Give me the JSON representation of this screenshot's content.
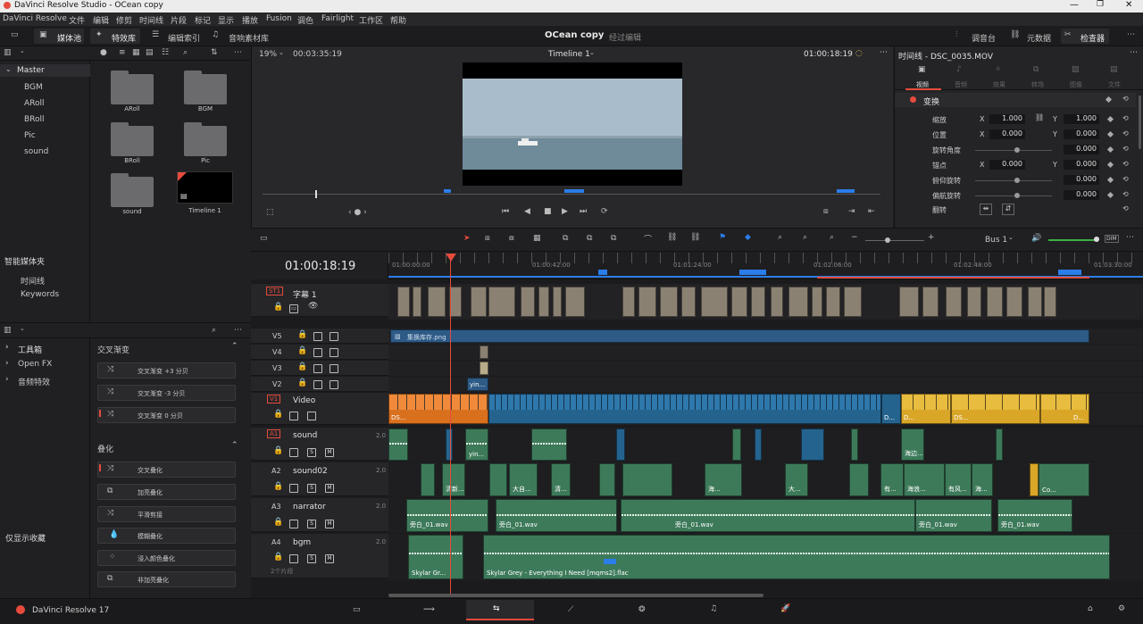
{
  "window": {
    "title": "DaVinci Resolve Studio - OCean copy"
  },
  "menu": [
    "DaVinci Resolve",
    "文件",
    "编辑",
    "修剪",
    "时间线",
    "片段",
    "标记",
    "显示",
    "播放",
    "Fusion",
    "调色",
    "Fairlight",
    "工作区",
    "帮助"
  ],
  "toolbar": {
    "media_pool": "媒体池",
    "effects": "特效库",
    "edit_index": "编辑索引",
    "sound_library": "音响素材库",
    "project_name": "OCean copy",
    "page_status": "经过编辑",
    "mixer": "调音台",
    "metadata": "元数据",
    "inspector": "检查器"
  },
  "viewer": {
    "zoom": "19%",
    "source_tc": "00:03:35:19",
    "timeline_name": "Timeline 1",
    "record_tc": "01:00:18:19"
  },
  "bins": {
    "master": "Master",
    "items": [
      "BGM",
      "ARoll",
      "BRoll",
      "Pic",
      "sound"
    ],
    "smart_bins_title": "智能媒体夹",
    "smart_items": [
      "时间线",
      "Keywords"
    ]
  },
  "clips": [
    {
      "name": "ARoll",
      "type": "folder"
    },
    {
      "name": "BGM",
      "type": "folder"
    },
    {
      "name": "BRoll",
      "type": "folder"
    },
    {
      "name": "Pic",
      "type": "folder"
    },
    {
      "name": "sound",
      "type": "folder"
    },
    {
      "name": "Timeline 1",
      "type": "timeline"
    }
  ],
  "effects_panel": {
    "tree": [
      "工具箱",
      "Open FX",
      "音频特效"
    ],
    "cat1": "交叉渐变",
    "cross": [
      "交叉渐变 +3 分贝",
      "交叉渐变 -3 分贝",
      "交叉渐变 0 分贝"
    ],
    "cat2": "叠化",
    "dissolves": [
      "交叉叠化",
      "加亮叠化",
      "平滑剪接",
      "模糊叠化",
      "浸入颜色叠化",
      "非加亮叠化"
    ],
    "show_favorites": "仅显示收藏"
  },
  "inspector": {
    "title": "时间线 - DSC_0035.MOV",
    "tabs": [
      "视频",
      "音频",
      "效果",
      "转场",
      "图像",
      "文件"
    ],
    "section": "变换",
    "rows": [
      {
        "label": "缩放",
        "x": "1.000",
        "y": "1.000"
      },
      {
        "label": "位置",
        "x": "0.000",
        "y": "0.000"
      },
      {
        "label": "旋转角度",
        "v": "0.000"
      },
      {
        "label": "锚点",
        "x": "0.000",
        "y": "0.000"
      },
      {
        "label": "俯仰旋转",
        "v": "0.000"
      },
      {
        "label": "偏航旋转",
        "v": "0.000"
      },
      {
        "label": "翻转"
      }
    ]
  },
  "timeline": {
    "current_tc": "01:00:18:19",
    "bus": "Bus 1",
    "ruler": [
      "01:00:00:00",
      "01:00:42:00",
      "01:01:24:00",
      "01:02:06:00",
      "01:02:48:00",
      "01:03:30:00"
    ],
    "tracks": [
      {
        "id": "ST1",
        "name": "字幕 1"
      },
      {
        "id": "V5",
        "name": ""
      },
      {
        "id": "V4",
        "name": ""
      },
      {
        "id": "V3",
        "name": ""
      },
      {
        "id": "V2",
        "name": ""
      },
      {
        "id": "V1",
        "name": "Video"
      },
      {
        "id": "A1",
        "name": "sound",
        "ch": "2.0"
      },
      {
        "id": "A2",
        "name": "sound02",
        "ch": "2.0"
      },
      {
        "id": "A3",
        "name": "narrator",
        "ch": "2.0"
      },
      {
        "id": "A4",
        "name": "bgm",
        "ch": "2.0",
        "count": "2个片段"
      }
    ],
    "clip_labels": {
      "v5": "集换库存.png",
      "v2": "yin...",
      "v1a": "DS...",
      "v1b": "D...",
      "v1c": "D...",
      "v1d": "DS...",
      "v1e": "D...",
      "a1": "yin...",
      "a1b": "海边...",
      "a2": [
        "清新...",
        "大自...",
        "清...",
        "海...",
        "大...",
        "有...",
        "海浪...",
        "有风...",
        "海...",
        "Co..."
      ],
      "a3": [
        "旁白_01.wav",
        "旁白_01.wav",
        "旁白_01.wav",
        "旁白_01.wav",
        "旁白_01.wav"
      ],
      "a4a": "Skylar Gr...",
      "a4b": "Skylar Grey - Everything I Need [mqms2].flac"
    }
  },
  "bottom": {
    "app": "DaVinci Resolve 17"
  },
  "colors": {
    "accent": "#e64b3c",
    "audio_clip": "#3d7a5a",
    "video_clip": "#24638e",
    "orange_clip": "#d9701e",
    "yellow_clip": "#d9a628",
    "playhead": "#e64b3c"
  }
}
